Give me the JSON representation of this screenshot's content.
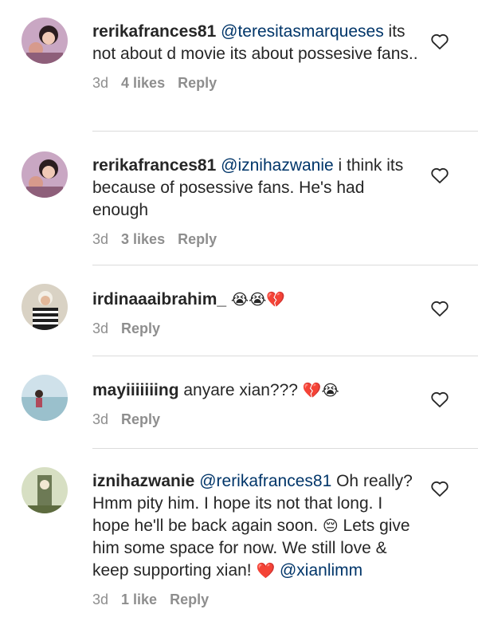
{
  "comments": [
    {
      "username": "rerikafrances81",
      "mention": "@teresitasmarqueses",
      "text": " its not about d movie its about possesive fans..",
      "time": "3d",
      "likes": "4 likes",
      "reply": "Reply"
    },
    {
      "username": "rerikafrances81",
      "mention": "@iznihazwanie",
      "text": " i think its because of posessive fans. He's had enough",
      "time": "3d",
      "likes": "3 likes",
      "reply": "Reply"
    },
    {
      "username": "irdinaaaibrahim_",
      "emoji": "😭😭💔",
      "time": "3d",
      "reply": "Reply"
    },
    {
      "username": "mayiiiiiiing",
      "text": " anyare xian???",
      "emoji": "💔😭",
      "time": "3d",
      "reply": "Reply"
    },
    {
      "username": "iznihazwanie",
      "mention": "@rerikafrances81",
      "text": " Oh really? Hmm pity him. I hope its not that long. I hope he'll be back again soon. ",
      "emoji1": "😔",
      "text2": " Lets give him some space for now. We still love & keep supporting xian! ",
      "emoji2": "❤️",
      "mention2": "@xianlimm",
      "time": "3d",
      "likes": "1 like",
      "reply": "Reply"
    }
  ],
  "colors": {
    "mention": "#003569",
    "meta": "#8e8e8e",
    "divider": "#dbdbdb"
  },
  "icons": {
    "like": "heart-outline-icon"
  }
}
